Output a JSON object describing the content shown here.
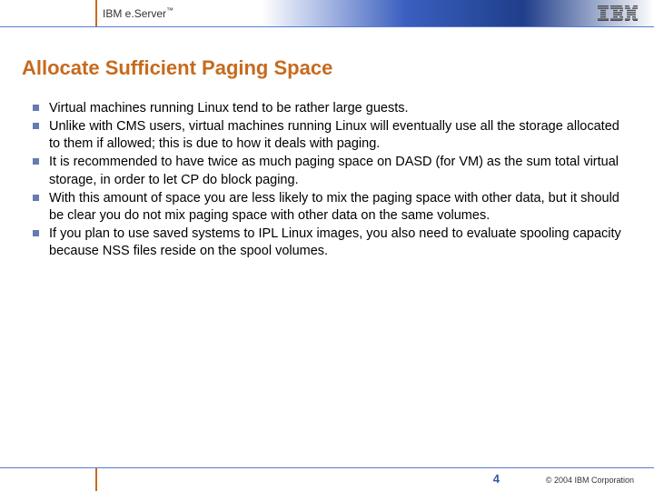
{
  "header": {
    "brand_prefix": "IBM e.",
    "brand_word": "Server",
    "brand_tm": "™",
    "logo_alt": "IBM"
  },
  "title": "Allocate Sufficient Paging Space",
  "bullets": [
    "Virtual machines running Linux tend to be rather large guests.",
    "Unlike with CMS users, virtual machines running Linux will eventually use all the storage allocated to them if allowed; this is due to how it deals with paging.",
    "It is recommended to have twice as much paging space on DASD (for VM) as the sum total virtual storage, in order to let CP do block paging.",
    "With this amount of space you are less likely to mix the paging space with other data, but it should be clear you do not mix paging space with other data on the same volumes.",
    "If you plan to use saved systems to IPL Linux images, you also need to evaluate spooling capacity because NSS files reside on the spool volumes."
  ],
  "footer": {
    "page": "4",
    "copyright": "© 2004 IBM Corporation"
  }
}
